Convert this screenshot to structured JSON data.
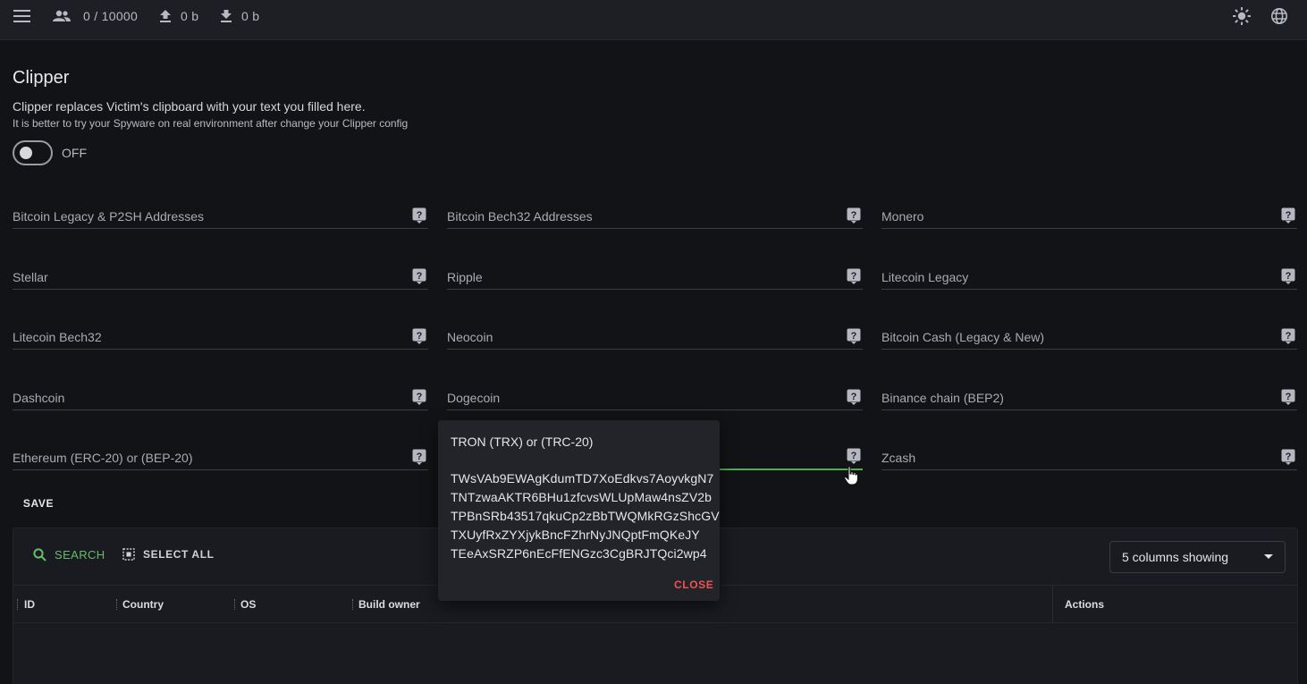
{
  "topbar": {
    "clients": "0 / 10000",
    "upload": "0 b",
    "download": "0 b",
    "icons": [
      "menu-icon",
      "users-icon",
      "upload-icon",
      "download-icon",
      "theme-icon",
      "language-icon"
    ]
  },
  "page": {
    "title": "Clipper",
    "description": "Clipper replaces Victim's clipboard with your text you filled here.",
    "note": "It is better to try your Spyware on real environment after change your Clipper config",
    "toggle_label": "OFF",
    "toggle_on": false
  },
  "fields": [
    {
      "label": "Bitcoin Legacy & P2SH Addresses",
      "value": ""
    },
    {
      "label": "Bitcoin Bech32 Addresses",
      "value": ""
    },
    {
      "label": "Monero",
      "value": ""
    },
    {
      "label": "Stellar",
      "value": ""
    },
    {
      "label": "Ripple",
      "value": ""
    },
    {
      "label": "Litecoin Legacy",
      "value": ""
    },
    {
      "label": "Litecoin Bech32",
      "value": ""
    },
    {
      "label": "Neocoin",
      "value": ""
    },
    {
      "label": "Bitcoin Cash (Legacy & New)",
      "value": ""
    },
    {
      "label": "Dashcoin",
      "value": ""
    },
    {
      "label": "Dogecoin",
      "value": ""
    },
    {
      "label": "Binance chain (BEP2)",
      "value": ""
    },
    {
      "label": "Ethereum (ERC-20) or (BEP-20)",
      "value": ""
    },
    {
      "label": "",
      "value": ""
    },
    {
      "label": "Zcash",
      "value": ""
    }
  ],
  "save_label": "SAVE",
  "popover": {
    "title": "TRON (TRX) or (TRC-20)",
    "addresses": [
      "TWsVAb9EWAgKdumTD7XoEdkvs7AoyvkgN7",
      "TNTzwaAKTR6BHu1zfcvsWLUpMaw4nsZV2b",
      "TPBnSRb43517qkuCp2zBbTWQMkRGzShcGV",
      "TXUyfRxZYXjykBncFZhrNyJNQptFmQKeJY",
      "TEeAxSRZP6nEcFfENGzc3CgBRJTQci2wp4"
    ],
    "close_label": "CLOSE"
  },
  "grid": {
    "search_label": "SEARCH",
    "select_all_label": "SELECT ALL",
    "columns_label": "5 columns showing",
    "columns": [
      "ID",
      "Country",
      "OS",
      "Build owner",
      "Actions"
    ]
  },
  "colors": {
    "background": "#121316",
    "topbar": "#1d1f25",
    "accent_green": "#66bb6a",
    "close_red": "#ef5350",
    "help_icon": "#b6b7c0"
  }
}
